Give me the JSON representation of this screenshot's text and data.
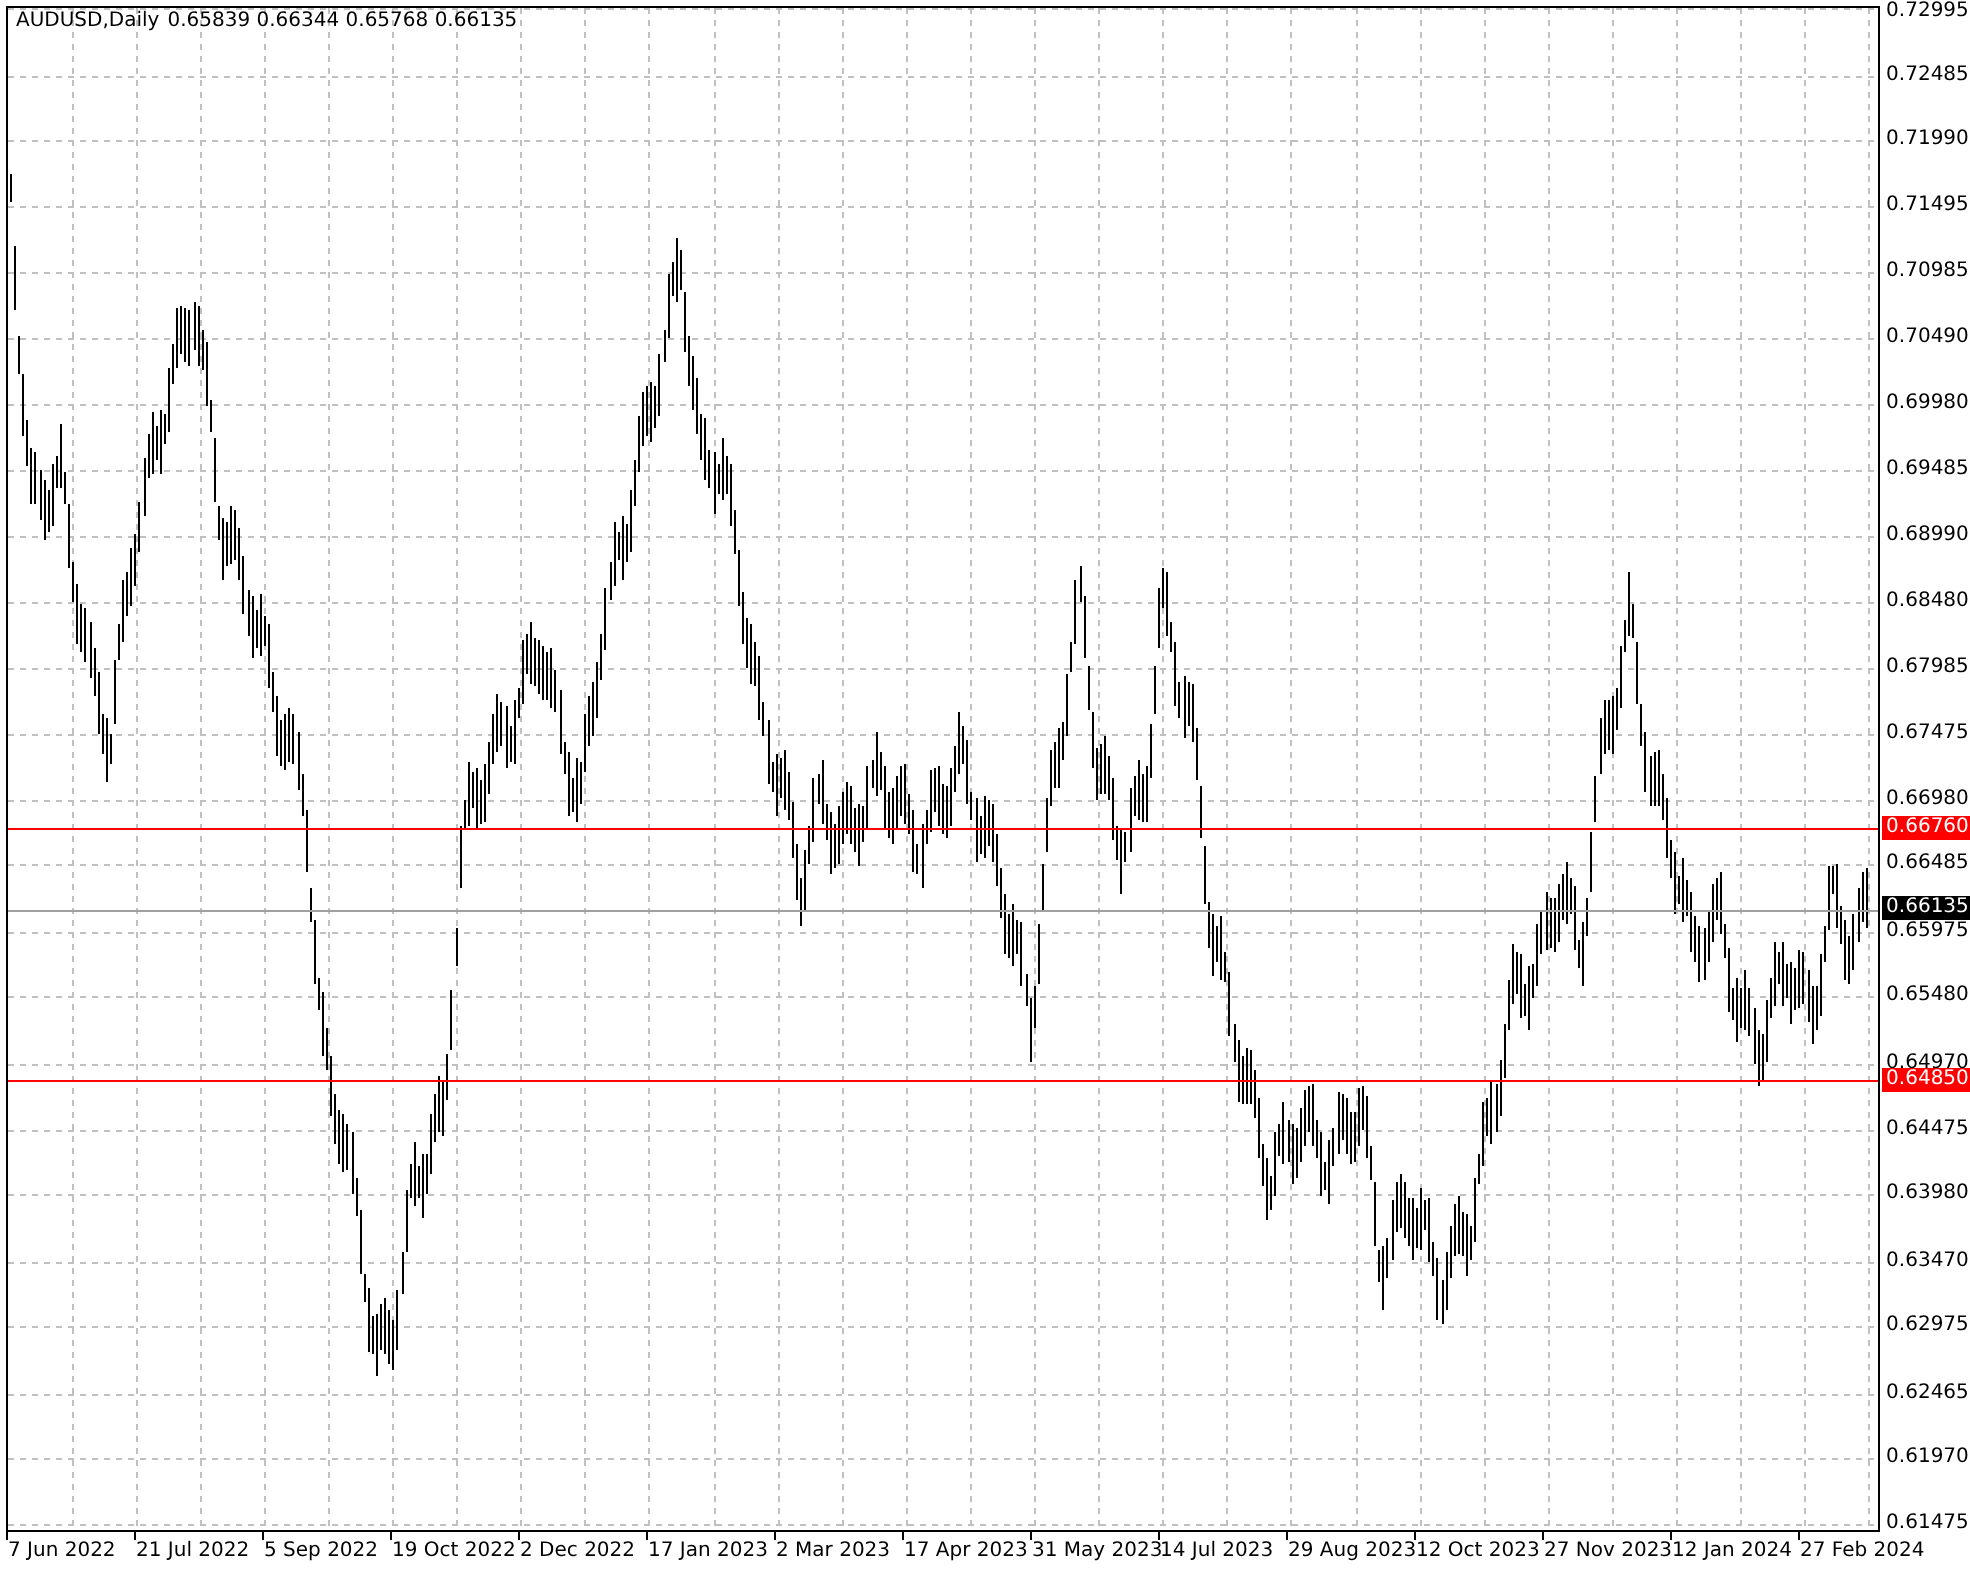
{
  "header": {
    "symbol": "AUDUSD,Daily",
    "ohlc": [
      "0.65839",
      "0.66344",
      "0.65768",
      "0.66135"
    ]
  },
  "price_axis": {
    "labels": [
      "0.72995",
      "0.72485",
      "0.71990",
      "0.71495",
      "0.70985",
      "0.70490",
      "0.69980",
      "0.69485",
      "0.68990",
      "0.68480",
      "0.67985",
      "0.67475",
      "0.66980",
      "0.66485",
      "0.65975",
      "0.65480",
      "0.64970",
      "0.64475",
      "0.63980",
      "0.63470",
      "0.62975",
      "0.62465",
      "0.61970",
      "0.61475"
    ]
  },
  "levels": [
    {
      "kind": "line",
      "price": "0.66760",
      "color": "#ff0000"
    },
    {
      "kind": "current",
      "price": "0.66135",
      "color": "#000000"
    },
    {
      "kind": "line",
      "price": "0.64850",
      "color": "#ff0000"
    }
  ],
  "date_axis": {
    "labels": [
      "7 Jun 2022",
      "21 Jul 2022",
      "5 Sep 2022",
      "19 Oct 2022",
      "2 Dec 2022",
      "17 Jan 2023",
      "2 Mar 2023",
      "17 Apr 2023",
      "31 May 2023",
      "14 Jul 2023",
      "29 Aug 2023",
      "12 Oct 2023",
      "27 Nov 2023",
      "12 Jan 2024",
      "27 Feb 2024"
    ]
  }
}
